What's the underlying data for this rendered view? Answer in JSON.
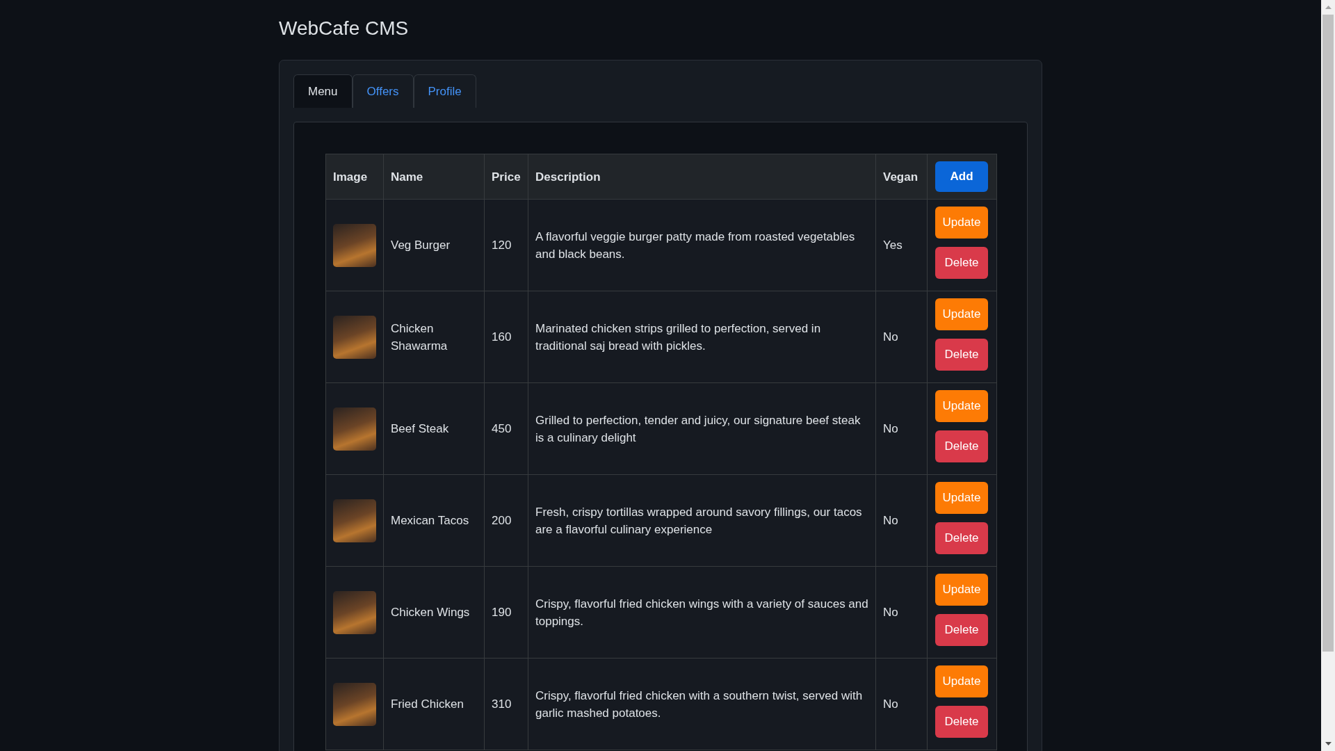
{
  "page": {
    "title": "WebCafe CMS"
  },
  "tabs": [
    {
      "label": "Menu",
      "selected": true
    },
    {
      "label": "Offers",
      "selected": false
    },
    {
      "label": "Profile",
      "selected": false
    }
  ],
  "table": {
    "columns": [
      "Image",
      "Name",
      "Price",
      "Description",
      "Vegan"
    ],
    "add_button": "Add",
    "rows": [
      {
        "name": "Veg Burger",
        "price": "120",
        "description": "A flavorful veggie burger patty made from roasted vegetables and black beans.",
        "vegan": "Yes",
        "update_button": "Update",
        "delete_button": "Delete"
      },
      {
        "name": "Chicken Shawarma",
        "price": "160",
        "description": "Marinated chicken strips grilled to perfection, served in traditional saj bread with pickles.",
        "vegan": "No",
        "update_button": "Update",
        "delete_button": "Delete"
      },
      {
        "name": "Beef Steak",
        "price": "450",
        "description": "Grilled to perfection, tender and juicy, our signature beef steak is a culinary delight",
        "vegan": "No",
        "update_button": "Update",
        "delete_button": "Delete"
      },
      {
        "name": "Mexican Tacos",
        "price": "200",
        "description": "Fresh, crispy tortillas wrapped around savory fillings, our tacos are a flavorful culinary experience",
        "vegan": "No",
        "update_button": "Update",
        "delete_button": "Delete"
      },
      {
        "name": "Chicken Wings",
        "price": "190",
        "description": "Crispy, flavorful fried chicken wings with a variety of sauces and toppings.",
        "vegan": "No",
        "update_button": "Update",
        "delete_button": "Delete"
      },
      {
        "name": "Fried Chicken",
        "price": "310",
        "description": "Crispy, flavorful fried chicken with a southern twist, served with garlic mashed potatoes.",
        "vegan": "No",
        "update_button": "Update",
        "delete_button": "Delete"
      }
    ]
  }
}
